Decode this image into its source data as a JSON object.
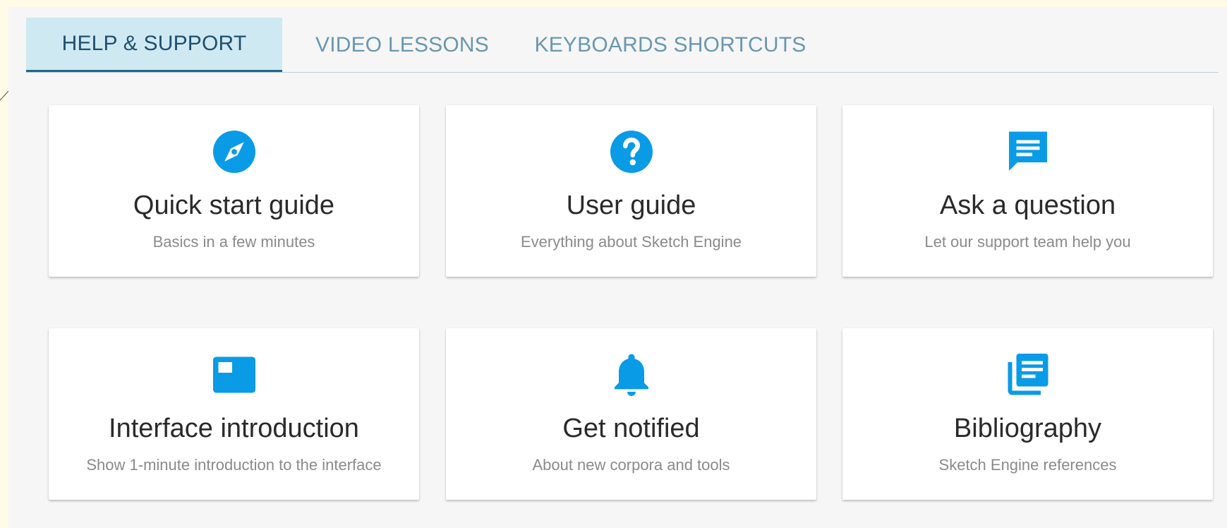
{
  "tabs": [
    {
      "label": "HELP & SUPPORT",
      "active": true
    },
    {
      "label": "VIDEO LESSONS",
      "active": false
    },
    {
      "label": "KEYBOARDS SHORTCUTS",
      "active": false
    }
  ],
  "colors": {
    "accent": "#0a9be6",
    "tab_active_bg": "#cfe9f3",
    "tab_active_text": "#1f4f6f",
    "tab_inactive_text": "#6a97b0"
  },
  "cards": [
    {
      "icon": "compass-icon",
      "title": "Quick start guide",
      "subtitle": "Basics in a few minutes"
    },
    {
      "icon": "help-circle-icon",
      "title": "User guide",
      "subtitle": "Everything about Sketch Engine"
    },
    {
      "icon": "chat-bubble-icon",
      "title": "Ask a question",
      "subtitle": "Let our support team help you"
    },
    {
      "icon": "interface-window-icon",
      "title": "Interface introduction",
      "subtitle": "Show 1-minute introduction to the interface"
    },
    {
      "icon": "bell-icon",
      "title": "Get notified",
      "subtitle": "About new corpora and tools"
    },
    {
      "icon": "library-books-icon",
      "title": "Bibliography",
      "subtitle": "Sketch Engine references"
    }
  ]
}
